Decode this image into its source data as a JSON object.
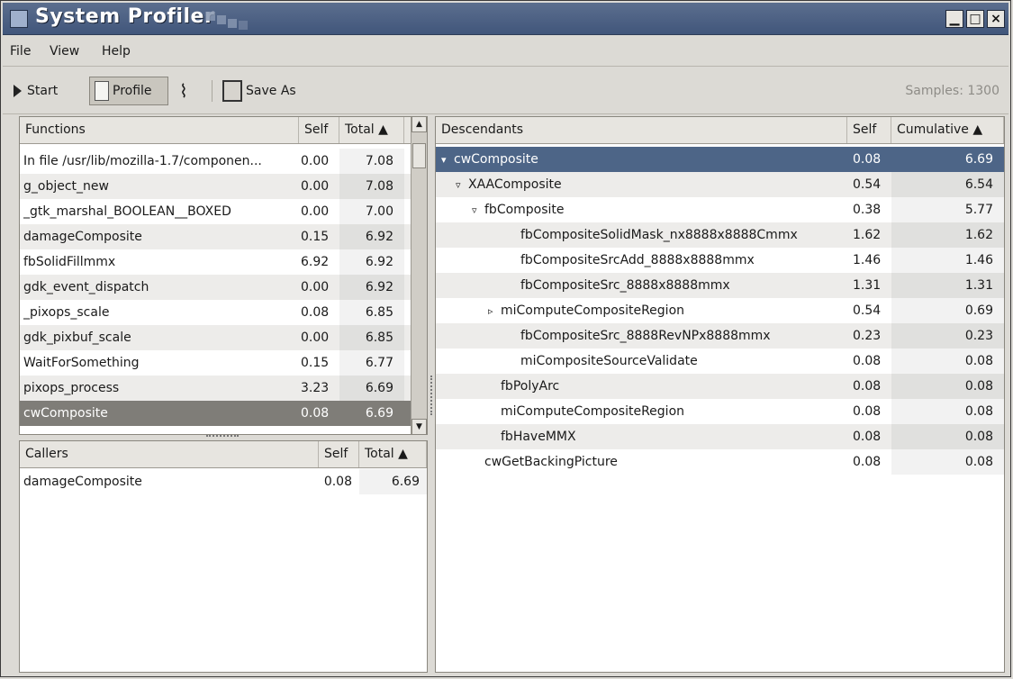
{
  "window": {
    "title": "System Profiler",
    "controls": {
      "minimize": "▁",
      "maximize": "□",
      "close": "×"
    }
  },
  "menubar": {
    "file": "File",
    "view": "View",
    "help": "Help"
  },
  "toolbar": {
    "start": "Start",
    "profile": "Profile",
    "save_as": "Save As",
    "samples": "Samples: 1300"
  },
  "functions": {
    "headers": {
      "name": "Functions",
      "self": "Self",
      "total": "Total ▲"
    },
    "rows": [
      {
        "name": "In file /usr/lib/mozilla-1.7/componen...",
        "self": "0.00",
        "total": "7.08"
      },
      {
        "name": "g_object_new",
        "self": "0.00",
        "total": "7.08"
      },
      {
        "name": "_gtk_marshal_BOOLEAN__BOXED",
        "self": "0.00",
        "total": "7.00"
      },
      {
        "name": "damageComposite",
        "self": "0.15",
        "total": "6.92"
      },
      {
        "name": "fbSolidFillmmx",
        "self": "6.92",
        "total": "6.92"
      },
      {
        "name": "gdk_event_dispatch",
        "self": "0.00",
        "total": "6.92"
      },
      {
        "name": "_pixops_scale",
        "self": "0.08",
        "total": "6.85"
      },
      {
        "name": "gdk_pixbuf_scale",
        "self": "0.00",
        "total": "6.85"
      },
      {
        "name": "WaitForSomething",
        "self": "0.15",
        "total": "6.77"
      },
      {
        "name": "pixops_process",
        "self": "3.23",
        "total": "6.69"
      },
      {
        "name": "cwComposite",
        "self": "0.08",
        "total": "6.69"
      }
    ]
  },
  "callers": {
    "headers": {
      "name": "Callers",
      "self": "Self",
      "total": "Total ▲"
    },
    "rows": [
      {
        "name": "damageComposite",
        "self": "0.08",
        "total": "6.69"
      }
    ]
  },
  "descendants": {
    "headers": {
      "name": "Descendants",
      "self": "Self",
      "cumulative": "Cumulative ▲"
    },
    "rows": [
      {
        "name": "cwComposite",
        "self": "0.08",
        "cumulative": "6.69",
        "expander": "▾"
      },
      {
        "name": "XAAComposite",
        "self": "0.54",
        "cumulative": "6.54",
        "expander": "▿"
      },
      {
        "name": "fbComposite",
        "self": "0.38",
        "cumulative": "5.77",
        "expander": "▿"
      },
      {
        "name": "fbCompositeSolidMask_nx8888x8888Cmmx",
        "self": "1.62",
        "cumulative": "1.62",
        "expander": ""
      },
      {
        "name": "fbCompositeSrcAdd_8888x8888mmx",
        "self": "1.46",
        "cumulative": "1.46",
        "expander": ""
      },
      {
        "name": "fbCompositeSrc_8888x8888mmx",
        "self": "1.31",
        "cumulative": "1.31",
        "expander": ""
      },
      {
        "name": "miComputeCompositeRegion",
        "self": "0.54",
        "cumulative": "0.69",
        "expander": "▹"
      },
      {
        "name": "fbCompositeSrc_8888RevNPx8888mmx",
        "self": "0.23",
        "cumulative": "0.23",
        "expander": ""
      },
      {
        "name": "miCompositeSourceValidate",
        "self": "0.08",
        "cumulative": "0.08",
        "expander": ""
      },
      {
        "name": "fbPolyArc",
        "self": "0.08",
        "cumulative": "0.08",
        "expander": ""
      },
      {
        "name": "miComputeCompositeRegion",
        "self": "0.08",
        "cumulative": "0.08",
        "expander": ""
      },
      {
        "name": "fbHaveMMX",
        "self": "0.08",
        "cumulative": "0.08",
        "expander": ""
      },
      {
        "name": "cwGetBackingPicture",
        "self": "0.08",
        "cumulative": "0.08",
        "expander": ""
      }
    ]
  },
  "colors": {
    "titlebar": "#4a5f82",
    "selection_focused": "#4d6587",
    "selection_unfocused": "#7f7d78"
  }
}
